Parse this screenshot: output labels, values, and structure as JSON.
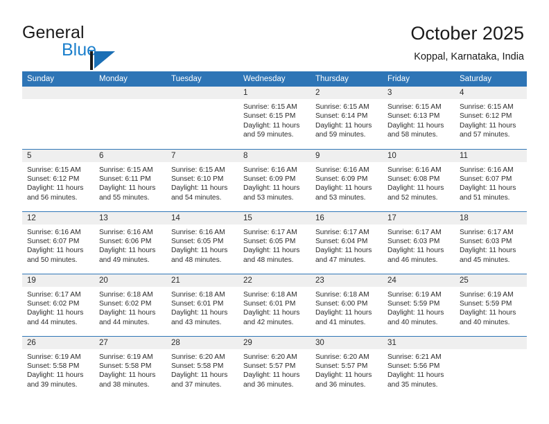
{
  "brand": {
    "word_one": "General",
    "word_two": "Blue",
    "mark": "blue-triangle-logo",
    "accent_color": "#1b7fcc"
  },
  "header": {
    "title": "October 2025",
    "subtitle": "Koppal, Karnataka, India"
  },
  "theme": {
    "header_blue": "#2E75B6",
    "daynum_band": "#efefef",
    "text": "#2a2a2a"
  },
  "calendar": {
    "weekday_headers": [
      "Sunday",
      "Monday",
      "Tuesday",
      "Wednesday",
      "Thursday",
      "Friday",
      "Saturday"
    ],
    "weeks": [
      [
        {
          "day": "",
          "lines": []
        },
        {
          "day": "",
          "lines": []
        },
        {
          "day": "",
          "lines": []
        },
        {
          "day": "1",
          "lines": [
            "Sunrise: 6:15 AM",
            "Sunset: 6:15 PM",
            "Daylight: 11 hours and 59 minutes."
          ]
        },
        {
          "day": "2",
          "lines": [
            "Sunrise: 6:15 AM",
            "Sunset: 6:14 PM",
            "Daylight: 11 hours and 59 minutes."
          ]
        },
        {
          "day": "3",
          "lines": [
            "Sunrise: 6:15 AM",
            "Sunset: 6:13 PM",
            "Daylight: 11 hours and 58 minutes."
          ]
        },
        {
          "day": "4",
          "lines": [
            "Sunrise: 6:15 AM",
            "Sunset: 6:12 PM",
            "Daylight: 11 hours and 57 minutes."
          ]
        }
      ],
      [
        {
          "day": "5",
          "lines": [
            "Sunrise: 6:15 AM",
            "Sunset: 6:12 PM",
            "Daylight: 11 hours and 56 minutes."
          ]
        },
        {
          "day": "6",
          "lines": [
            "Sunrise: 6:15 AM",
            "Sunset: 6:11 PM",
            "Daylight: 11 hours and 55 minutes."
          ]
        },
        {
          "day": "7",
          "lines": [
            "Sunrise: 6:15 AM",
            "Sunset: 6:10 PM",
            "Daylight: 11 hours and 54 minutes."
          ]
        },
        {
          "day": "8",
          "lines": [
            "Sunrise: 6:16 AM",
            "Sunset: 6:09 PM",
            "Daylight: 11 hours and 53 minutes."
          ]
        },
        {
          "day": "9",
          "lines": [
            "Sunrise: 6:16 AM",
            "Sunset: 6:09 PM",
            "Daylight: 11 hours and 53 minutes."
          ]
        },
        {
          "day": "10",
          "lines": [
            "Sunrise: 6:16 AM",
            "Sunset: 6:08 PM",
            "Daylight: 11 hours and 52 minutes."
          ]
        },
        {
          "day": "11",
          "lines": [
            "Sunrise: 6:16 AM",
            "Sunset: 6:07 PM",
            "Daylight: 11 hours and 51 minutes."
          ]
        }
      ],
      [
        {
          "day": "12",
          "lines": [
            "Sunrise: 6:16 AM",
            "Sunset: 6:07 PM",
            "Daylight: 11 hours and 50 minutes."
          ]
        },
        {
          "day": "13",
          "lines": [
            "Sunrise: 6:16 AM",
            "Sunset: 6:06 PM",
            "Daylight: 11 hours and 49 minutes."
          ]
        },
        {
          "day": "14",
          "lines": [
            "Sunrise: 6:16 AM",
            "Sunset: 6:05 PM",
            "Daylight: 11 hours and 48 minutes."
          ]
        },
        {
          "day": "15",
          "lines": [
            "Sunrise: 6:17 AM",
            "Sunset: 6:05 PM",
            "Daylight: 11 hours and 48 minutes."
          ]
        },
        {
          "day": "16",
          "lines": [
            "Sunrise: 6:17 AM",
            "Sunset: 6:04 PM",
            "Daylight: 11 hours and 47 minutes."
          ]
        },
        {
          "day": "17",
          "lines": [
            "Sunrise: 6:17 AM",
            "Sunset: 6:03 PM",
            "Daylight: 11 hours and 46 minutes."
          ]
        },
        {
          "day": "18",
          "lines": [
            "Sunrise: 6:17 AM",
            "Sunset: 6:03 PM",
            "Daylight: 11 hours and 45 minutes."
          ]
        }
      ],
      [
        {
          "day": "19",
          "lines": [
            "Sunrise: 6:17 AM",
            "Sunset: 6:02 PM",
            "Daylight: 11 hours and 44 minutes."
          ]
        },
        {
          "day": "20",
          "lines": [
            "Sunrise: 6:18 AM",
            "Sunset: 6:02 PM",
            "Daylight: 11 hours and 44 minutes."
          ]
        },
        {
          "day": "21",
          "lines": [
            "Sunrise: 6:18 AM",
            "Sunset: 6:01 PM",
            "Daylight: 11 hours and 43 minutes."
          ]
        },
        {
          "day": "22",
          "lines": [
            "Sunrise: 6:18 AM",
            "Sunset: 6:01 PM",
            "Daylight: 11 hours and 42 minutes."
          ]
        },
        {
          "day": "23",
          "lines": [
            "Sunrise: 6:18 AM",
            "Sunset: 6:00 PM",
            "Daylight: 11 hours and 41 minutes."
          ]
        },
        {
          "day": "24",
          "lines": [
            "Sunrise: 6:19 AM",
            "Sunset: 5:59 PM",
            "Daylight: 11 hours and 40 minutes."
          ]
        },
        {
          "day": "25",
          "lines": [
            "Sunrise: 6:19 AM",
            "Sunset: 5:59 PM",
            "Daylight: 11 hours and 40 minutes."
          ]
        }
      ],
      [
        {
          "day": "26",
          "lines": [
            "Sunrise: 6:19 AM",
            "Sunset: 5:58 PM",
            "Daylight: 11 hours and 39 minutes."
          ]
        },
        {
          "day": "27",
          "lines": [
            "Sunrise: 6:19 AM",
            "Sunset: 5:58 PM",
            "Daylight: 11 hours and 38 minutes."
          ]
        },
        {
          "day": "28",
          "lines": [
            "Sunrise: 6:20 AM",
            "Sunset: 5:58 PM",
            "Daylight: 11 hours and 37 minutes."
          ]
        },
        {
          "day": "29",
          "lines": [
            "Sunrise: 6:20 AM",
            "Sunset: 5:57 PM",
            "Daylight: 11 hours and 36 minutes."
          ]
        },
        {
          "day": "30",
          "lines": [
            "Sunrise: 6:20 AM",
            "Sunset: 5:57 PM",
            "Daylight: 11 hours and 36 minutes."
          ]
        },
        {
          "day": "31",
          "lines": [
            "Sunrise: 6:21 AM",
            "Sunset: 5:56 PM",
            "Daylight: 11 hours and 35 minutes."
          ]
        },
        {
          "day": "",
          "lines": []
        }
      ]
    ]
  }
}
